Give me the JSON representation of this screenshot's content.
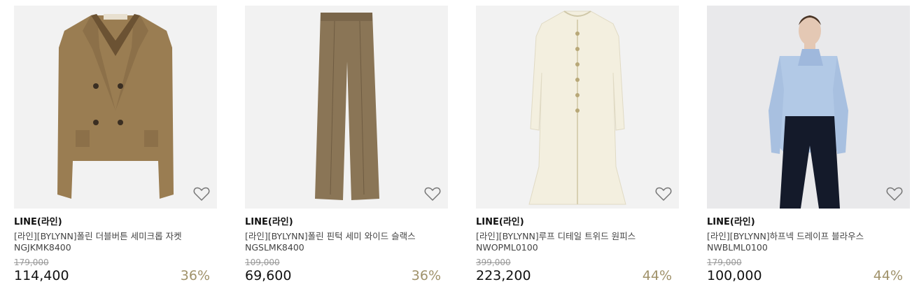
{
  "products": [
    {
      "brand": "LINE(라인)",
      "name": "[라인][BYLYNN]폴린 더블버튼 세미크롭 자켓",
      "code": "NGJKMK8400",
      "original_price": "179,000",
      "price": "114,400",
      "discount": "36%",
      "wishlist_icon": "heart-outline-icon"
    },
    {
      "brand": "LINE(라인)",
      "name": "[라인][BYLYNN]폴린 핀턱 세미 와이드 슬랙스",
      "code": "NGSLMK8400",
      "original_price": "109,000",
      "price": "69,600",
      "discount": "36%",
      "wishlist_icon": "heart-outline-icon"
    },
    {
      "brand": "LINE(라인)",
      "name": "[라인][BYLYNN]루프 디테일 트위드 원피스",
      "code": "NWOPML0100",
      "original_price": "399,000",
      "price": "223,200",
      "discount": "44%",
      "wishlist_icon": "heart-outline-icon"
    },
    {
      "brand": "LINE(라인)",
      "name": "[라인][BYLYNN]하프넥 드레이프 블라우스",
      "code": "NWBLML0100",
      "original_price": "179,000",
      "price": "100,000",
      "discount": "44%",
      "wishlist_icon": "heart-outline-icon"
    }
  ],
  "colors": {
    "discount": "#a0926a",
    "thumb_bg": "#f2f2f2",
    "jacket": "#9a7d52",
    "pants": "#8a7556",
    "dress": "#f3efdf",
    "blouse": "#b2c9e6"
  }
}
